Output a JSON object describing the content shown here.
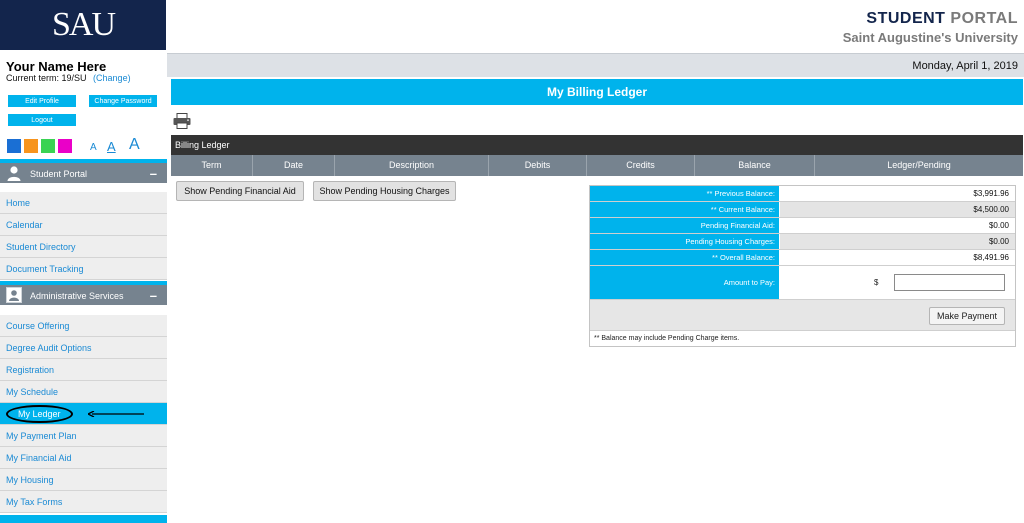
{
  "header": {
    "logo": "SAU",
    "portal_title_1": "STUDENT",
    "portal_title_2": "PORTAL",
    "portal_subtitle": "Saint Augustine's University",
    "date": "Monday, April 1, 2019"
  },
  "user": {
    "name": "Your Name Here",
    "term_label": "Current term: 19/SU",
    "change_link": "(Change)",
    "edit_profile": "Edit Profile",
    "change_password": "Change Password",
    "logout": "Logout"
  },
  "colors": {
    "swatches": [
      "#1a6fd4",
      "#f7941d",
      "#39d353",
      "#ea00c8"
    ],
    "accent": "#00b3ec",
    "navy": "#13254c",
    "section_gray": "#76838f"
  },
  "font_sizes": [
    "A",
    "A",
    "A"
  ],
  "sidebar": {
    "section1": {
      "label": "Student Portal",
      "icon": "user-icon",
      "toggle": "–"
    },
    "section1_items": [
      "Home",
      "Calendar",
      "Student Directory",
      "Document Tracking"
    ],
    "section2": {
      "label": "Administrative Services",
      "icon": "admin-icon",
      "toggle": "–"
    },
    "section2_items": [
      "Course Offering",
      "Degree Audit Options",
      "Registration",
      "My Schedule",
      "My Ledger",
      "My Payment Plan",
      "My Financial Aid",
      "My Housing",
      "My Tax Forms"
    ]
  },
  "main": {
    "page_title": "My Billing Ledger",
    "billing_label": "Billing Ledger",
    "columns": [
      "Term",
      "Date",
      "Description",
      "Debits",
      "Credits",
      "Balance",
      "Ledger/Pending"
    ],
    "btn_pending_aid": "Show Pending Financial Aid",
    "btn_pending_housing": "Show Pending Housing Charges"
  },
  "balances": {
    "previous_label": "** Previous Balance:",
    "previous_value": "$3,991.96",
    "current_label": "** Current Balance:",
    "current_value": "$4,500.00",
    "pending_aid_label": "Pending Financial Aid:",
    "pending_aid_value": "$0.00",
    "pending_housing_label": "Pending Housing Charges:",
    "pending_housing_value": "$0.00",
    "overall_label": "** Overall Balance:",
    "overall_value": "$8,491.96",
    "amount_label": "Amount to Pay:",
    "dollar": "$",
    "amount_value": "",
    "make_payment": "Make Payment",
    "note": "** Balance may include Pending Charge items."
  }
}
